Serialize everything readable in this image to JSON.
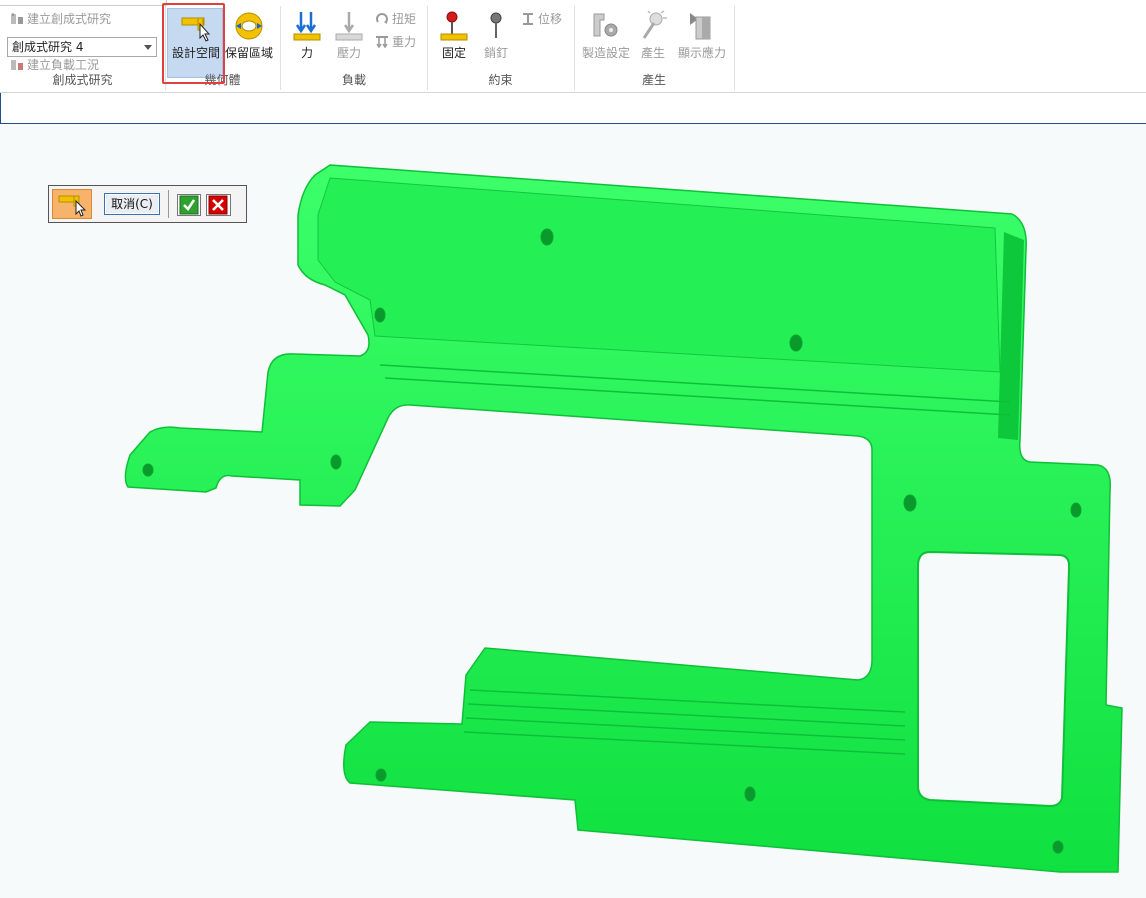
{
  "ribbon": {
    "generative_study": {
      "create_study": "建立創成式研究",
      "study_name": "創成式研究 4",
      "create_load_case": "建立負載工況",
      "group_label": "創成式研究"
    },
    "geometry": {
      "design_space": "設計空間",
      "preserved_region": "保留區域",
      "group_label": "幾何體"
    },
    "loads": {
      "force": "力",
      "pressure": "壓力",
      "torque": "扭矩",
      "gravity": "重力",
      "group_label": "負載"
    },
    "constraints": {
      "fixed": "固定",
      "pin": "銷釘",
      "displacement": "位移",
      "group_label": "約束"
    },
    "generate": {
      "manufacturing_settings": "製造設定",
      "generate": "產生",
      "show_stress": "顯示應力",
      "group_label": "產生"
    }
  },
  "command_bar": {
    "cancel_label": "取消(C)"
  },
  "colors": {
    "model_green": "#16e64a",
    "active_button": "#c5d9f1",
    "highlight_frame": "#e04040",
    "ok_green": "#2ea12e",
    "cancel_red": "#d40000"
  }
}
